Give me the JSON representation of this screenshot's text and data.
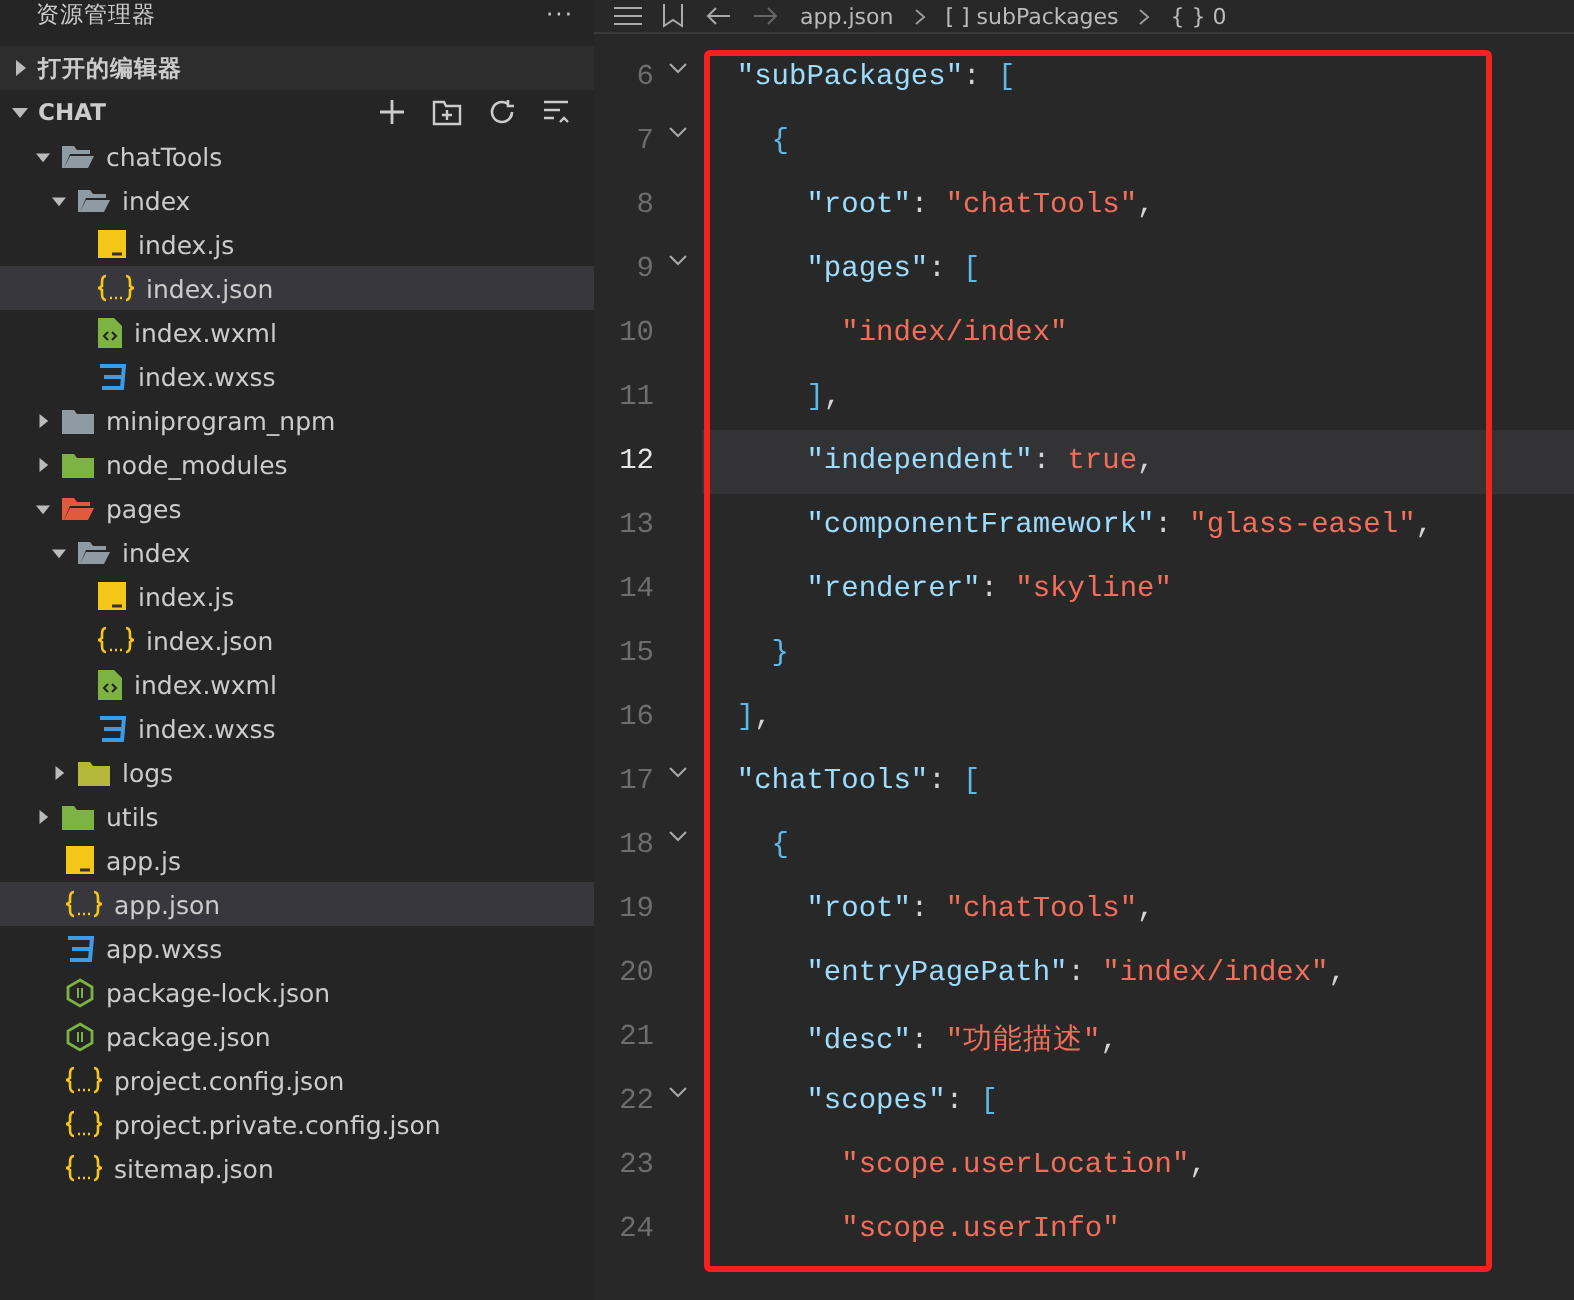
{
  "sidebar": {
    "title": "资源管理器",
    "more": "···",
    "sections": [
      {
        "label": "打开的编辑器",
        "expanded": false
      },
      {
        "label": "CHAT",
        "expanded": true
      }
    ],
    "tree": [
      {
        "label": "chatTools",
        "kind": "folder",
        "color": "#8f9ba3",
        "expanded": true,
        "selected": false,
        "children": [
          {
            "label": "index",
            "kind": "folder",
            "color": "#8f9ba3",
            "expanded": true,
            "selected": false,
            "children": [
              {
                "label": "index.js",
                "kind": "js",
                "selected": false
              },
              {
                "label": "index.json",
                "kind": "json",
                "selected": true
              },
              {
                "label": "index.wxml",
                "kind": "wxml",
                "selected": false
              },
              {
                "label": "index.wxss",
                "kind": "wxss",
                "selected": false
              }
            ]
          }
        ]
      },
      {
        "label": "miniprogram_npm",
        "kind": "folder",
        "color": "#8f9ba3",
        "expanded": false,
        "selected": false
      },
      {
        "label": "node_modules",
        "kind": "folder",
        "color": "#7cb342",
        "expanded": false,
        "selected": false
      },
      {
        "label": "pages",
        "kind": "folder",
        "color": "#e05a3c",
        "expanded": true,
        "selected": false,
        "children": [
          {
            "label": "index",
            "kind": "folder",
            "color": "#8f9ba3",
            "expanded": true,
            "selected": false,
            "children": [
              {
                "label": "index.js",
                "kind": "js",
                "selected": false
              },
              {
                "label": "index.json",
                "kind": "json",
                "selected": false
              },
              {
                "label": "index.wxml",
                "kind": "wxml",
                "selected": false
              },
              {
                "label": "index.wxss",
                "kind": "wxss",
                "selected": false
              }
            ]
          },
          {
            "label": "logs",
            "kind": "folder",
            "color": "#b5b83a",
            "expanded": false,
            "selected": false
          }
        ]
      },
      {
        "label": "utils",
        "kind": "folder",
        "color": "#7cb342",
        "expanded": false,
        "selected": false
      },
      {
        "label": "app.js",
        "kind": "js",
        "selected": false
      },
      {
        "label": "app.json",
        "kind": "json",
        "selected": true
      },
      {
        "label": "app.wxss",
        "kind": "wxss",
        "selected": false
      },
      {
        "label": "package-lock.json",
        "kind": "node",
        "selected": false
      },
      {
        "label": "package.json",
        "kind": "node",
        "selected": false
      },
      {
        "label": "project.config.json",
        "kind": "json",
        "selected": false
      },
      {
        "label": "project.private.config.json",
        "kind": "json",
        "selected": false
      },
      {
        "label": "sitemap.json",
        "kind": "json",
        "selected": false
      }
    ]
  },
  "breadcrumb": [
    "app.json",
    "[ ] subPackages",
    "{ } 0"
  ],
  "lines": [
    {
      "number": "6",
      "fold": true,
      "active": false,
      "tokens": [
        {
          "kind": "key",
          "text": "  \"subPackages\""
        },
        {
          "kind": "punct",
          "text": ": "
        },
        {
          "kind": "bracket",
          "text": "["
        }
      ]
    },
    {
      "number": "7",
      "fold": true,
      "active": false,
      "tokens": [
        {
          "kind": "bracket",
          "text": "    {"
        }
      ]
    },
    {
      "number": "8",
      "fold": false,
      "active": false,
      "tokens": [
        {
          "kind": "key",
          "text": "      \"root\""
        },
        {
          "kind": "punct",
          "text": ": "
        },
        {
          "kind": "string",
          "text": "\"chatTools\""
        },
        {
          "kind": "punct",
          "text": ","
        }
      ]
    },
    {
      "number": "9",
      "fold": true,
      "active": false,
      "tokens": [
        {
          "kind": "key",
          "text": "      \"pages\""
        },
        {
          "kind": "punct",
          "text": ": "
        },
        {
          "kind": "bracket",
          "text": "["
        }
      ]
    },
    {
      "number": "10",
      "fold": false,
      "active": false,
      "tokens": [
        {
          "kind": "string",
          "text": "        \"index/index\""
        }
      ]
    },
    {
      "number": "11",
      "fold": false,
      "active": false,
      "tokens": [
        {
          "kind": "bracket",
          "text": "      ]"
        },
        {
          "kind": "punct",
          "text": ","
        }
      ]
    },
    {
      "number": "12",
      "fold": false,
      "active": true,
      "tokens": [
        {
          "kind": "key",
          "text": "      \"independent\""
        },
        {
          "kind": "punct",
          "text": ": "
        },
        {
          "kind": "bool",
          "text": "true"
        },
        {
          "kind": "punct",
          "text": ","
        }
      ]
    },
    {
      "number": "13",
      "fold": false,
      "active": false,
      "tokens": [
        {
          "kind": "key",
          "text": "      \"componentFramework\""
        },
        {
          "kind": "punct",
          "text": ": "
        },
        {
          "kind": "string",
          "text": "\"glass-easel\""
        },
        {
          "kind": "punct",
          "text": ","
        }
      ]
    },
    {
      "number": "14",
      "fold": false,
      "active": false,
      "tokens": [
        {
          "kind": "key",
          "text": "      \"renderer\""
        },
        {
          "kind": "punct",
          "text": ": "
        },
        {
          "kind": "string",
          "text": "\"skyline\""
        }
      ]
    },
    {
      "number": "15",
      "fold": false,
      "active": false,
      "tokens": [
        {
          "kind": "bracket",
          "text": "    }"
        }
      ]
    },
    {
      "number": "16",
      "fold": false,
      "active": false,
      "tokens": [
        {
          "kind": "bracket",
          "text": "  ]"
        },
        {
          "kind": "punct",
          "text": ","
        }
      ]
    },
    {
      "number": "17",
      "fold": true,
      "active": false,
      "tokens": [
        {
          "kind": "key",
          "text": "  \"chatTools\""
        },
        {
          "kind": "punct",
          "text": ": "
        },
        {
          "kind": "bracket",
          "text": "["
        }
      ]
    },
    {
      "number": "18",
      "fold": true,
      "active": false,
      "tokens": [
        {
          "kind": "bracket",
          "text": "    {"
        }
      ]
    },
    {
      "number": "19",
      "fold": false,
      "active": false,
      "tokens": [
        {
          "kind": "key",
          "text": "      \"root\""
        },
        {
          "kind": "punct",
          "text": ": "
        },
        {
          "kind": "string",
          "text": "\"chatTools\""
        },
        {
          "kind": "punct",
          "text": ","
        }
      ]
    },
    {
      "number": "20",
      "fold": false,
      "active": false,
      "tokens": [
        {
          "kind": "key",
          "text": "      \"entryPagePath\""
        },
        {
          "kind": "punct",
          "text": ": "
        },
        {
          "kind": "string",
          "text": "\"index/index\""
        },
        {
          "kind": "punct",
          "text": ","
        }
      ]
    },
    {
      "number": "21",
      "fold": false,
      "active": false,
      "tokens": [
        {
          "kind": "key",
          "text": "      \"desc\""
        },
        {
          "kind": "punct",
          "text": ": "
        },
        {
          "kind": "string",
          "text": "\"功能描述\""
        },
        {
          "kind": "punct",
          "text": ","
        }
      ]
    },
    {
      "number": "22",
      "fold": true,
      "active": false,
      "tokens": [
        {
          "kind": "key",
          "text": "      \"scopes\""
        },
        {
          "kind": "punct",
          "text": ": "
        },
        {
          "kind": "bracket",
          "text": "["
        }
      ]
    },
    {
      "number": "23",
      "fold": false,
      "active": false,
      "tokens": [
        {
          "kind": "string",
          "text": "        \"scope.userLocation\""
        },
        {
          "kind": "punct",
          "text": ","
        }
      ]
    },
    {
      "number": "24",
      "fold": false,
      "active": false,
      "tokens": [
        {
          "kind": "string",
          "text": "        \"scope.userInfo\""
        }
      ]
    }
  ],
  "highlight_box": true
}
